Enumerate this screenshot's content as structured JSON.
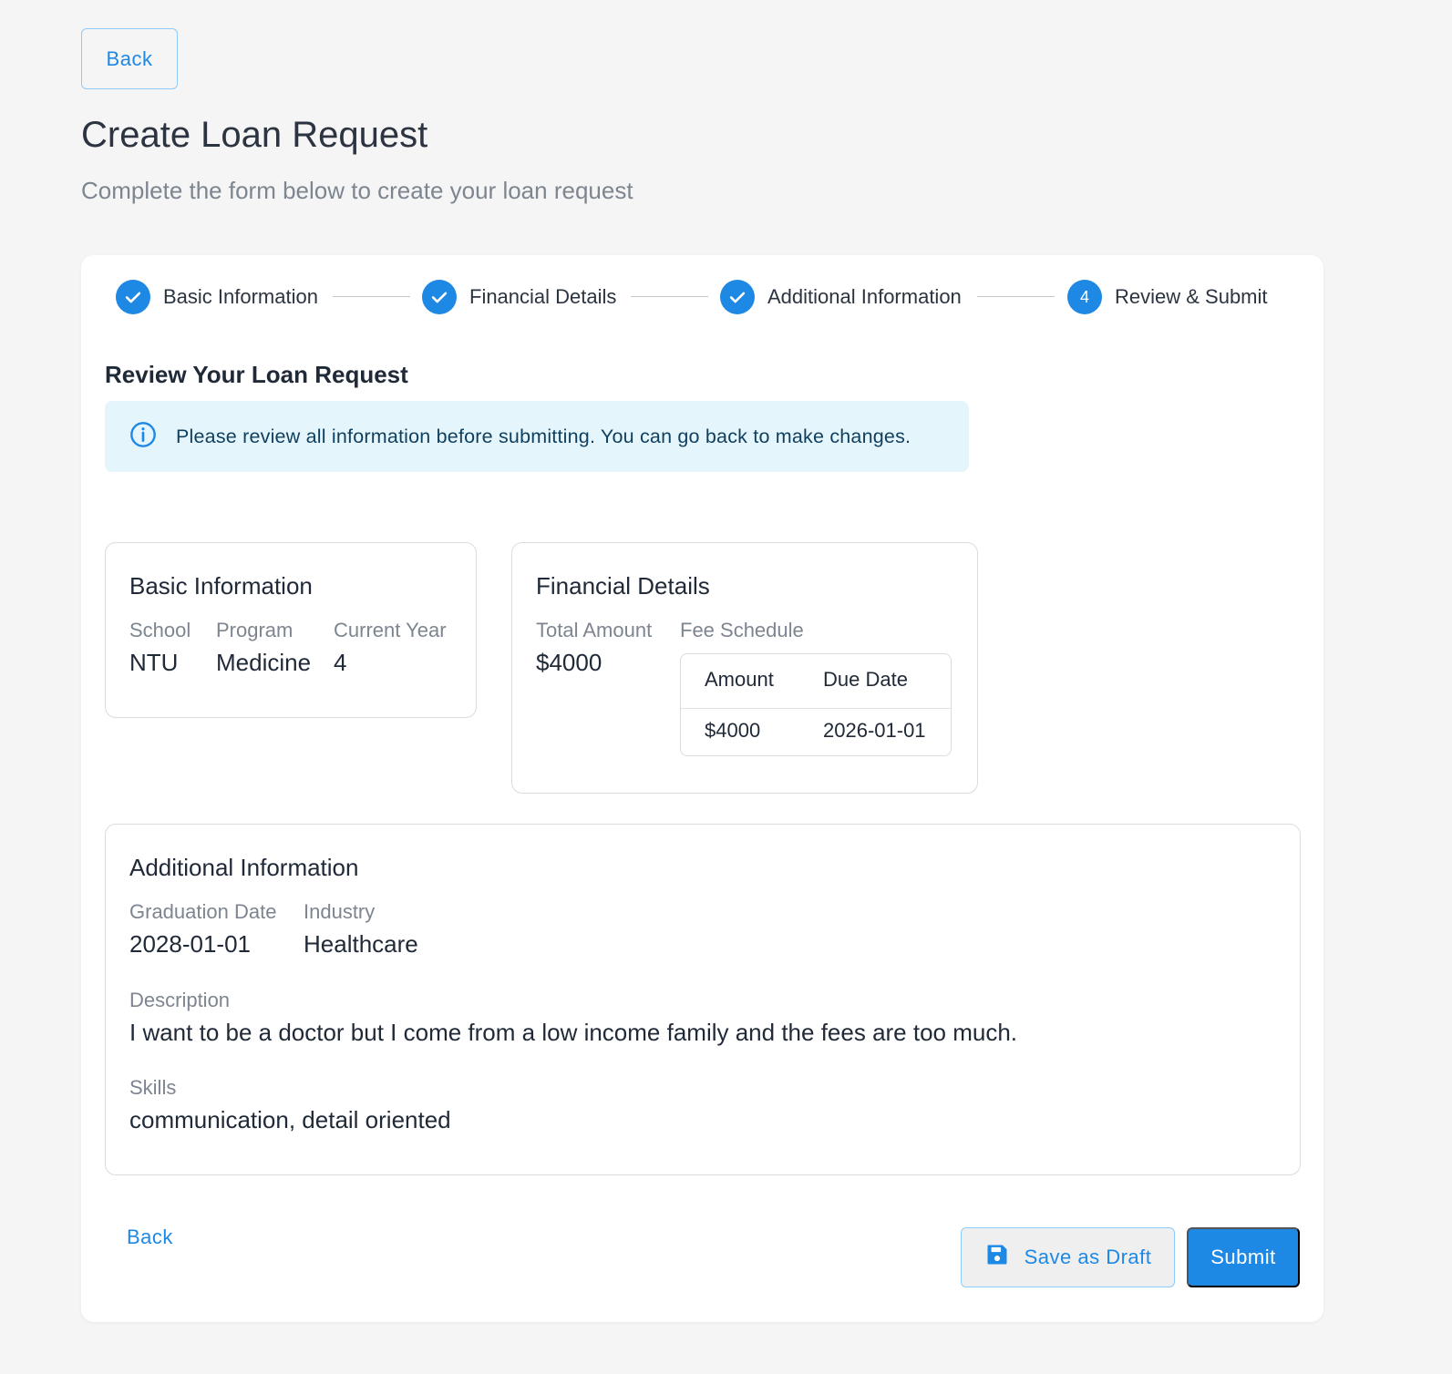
{
  "header": {
    "back_label": "Back",
    "title": "Create Loan Request",
    "subtitle": "Complete the form below to create your loan request"
  },
  "stepper": {
    "steps": [
      {
        "label": "Basic Information",
        "status": "completed",
        "icon": "check-icon"
      },
      {
        "label": "Financial Details",
        "status": "completed",
        "icon": "check-icon"
      },
      {
        "label": "Additional Information",
        "status": "completed",
        "icon": "check-icon"
      },
      {
        "label": "Review & Submit",
        "status": "active",
        "number": "4"
      }
    ]
  },
  "review": {
    "title": "Review Your Loan Request",
    "alert_text": "Please review all information before submitting. You can go back to make changes.",
    "alert_icon": "info-icon"
  },
  "basic_info": {
    "title": "Basic Information",
    "school_label": "School",
    "school_value": "NTU",
    "program_label": "Program",
    "program_value": "Medicine",
    "year_label": "Current Year",
    "year_value": "4"
  },
  "financial": {
    "title": "Financial Details",
    "total_label": "Total Amount",
    "total_value": "$4000",
    "schedule_label": "Fee Schedule",
    "table": {
      "headers": [
        "Amount",
        "Due Date"
      ],
      "rows": [
        [
          "$4000",
          "2026-01-01"
        ]
      ]
    }
  },
  "additional": {
    "title": "Additional Information",
    "grad_label": "Graduation Date",
    "grad_value": "2028-01-01",
    "industry_label": "Industry",
    "industry_value": "Healthcare",
    "desc_label": "Description",
    "desc_value": "I want to be a doctor but I come from a low income family and the fees are too much.",
    "skills_label": "Skills",
    "skills_value": "communication, detail oriented"
  },
  "actions": {
    "back_label": "Back",
    "draft_label": "Save as Draft",
    "draft_icon": "save-icon",
    "submit_label": "Submit"
  },
  "colors": {
    "accent": "#1e88e5",
    "background": "#f5f5f5",
    "alert_bg": "#e5f5fc"
  }
}
